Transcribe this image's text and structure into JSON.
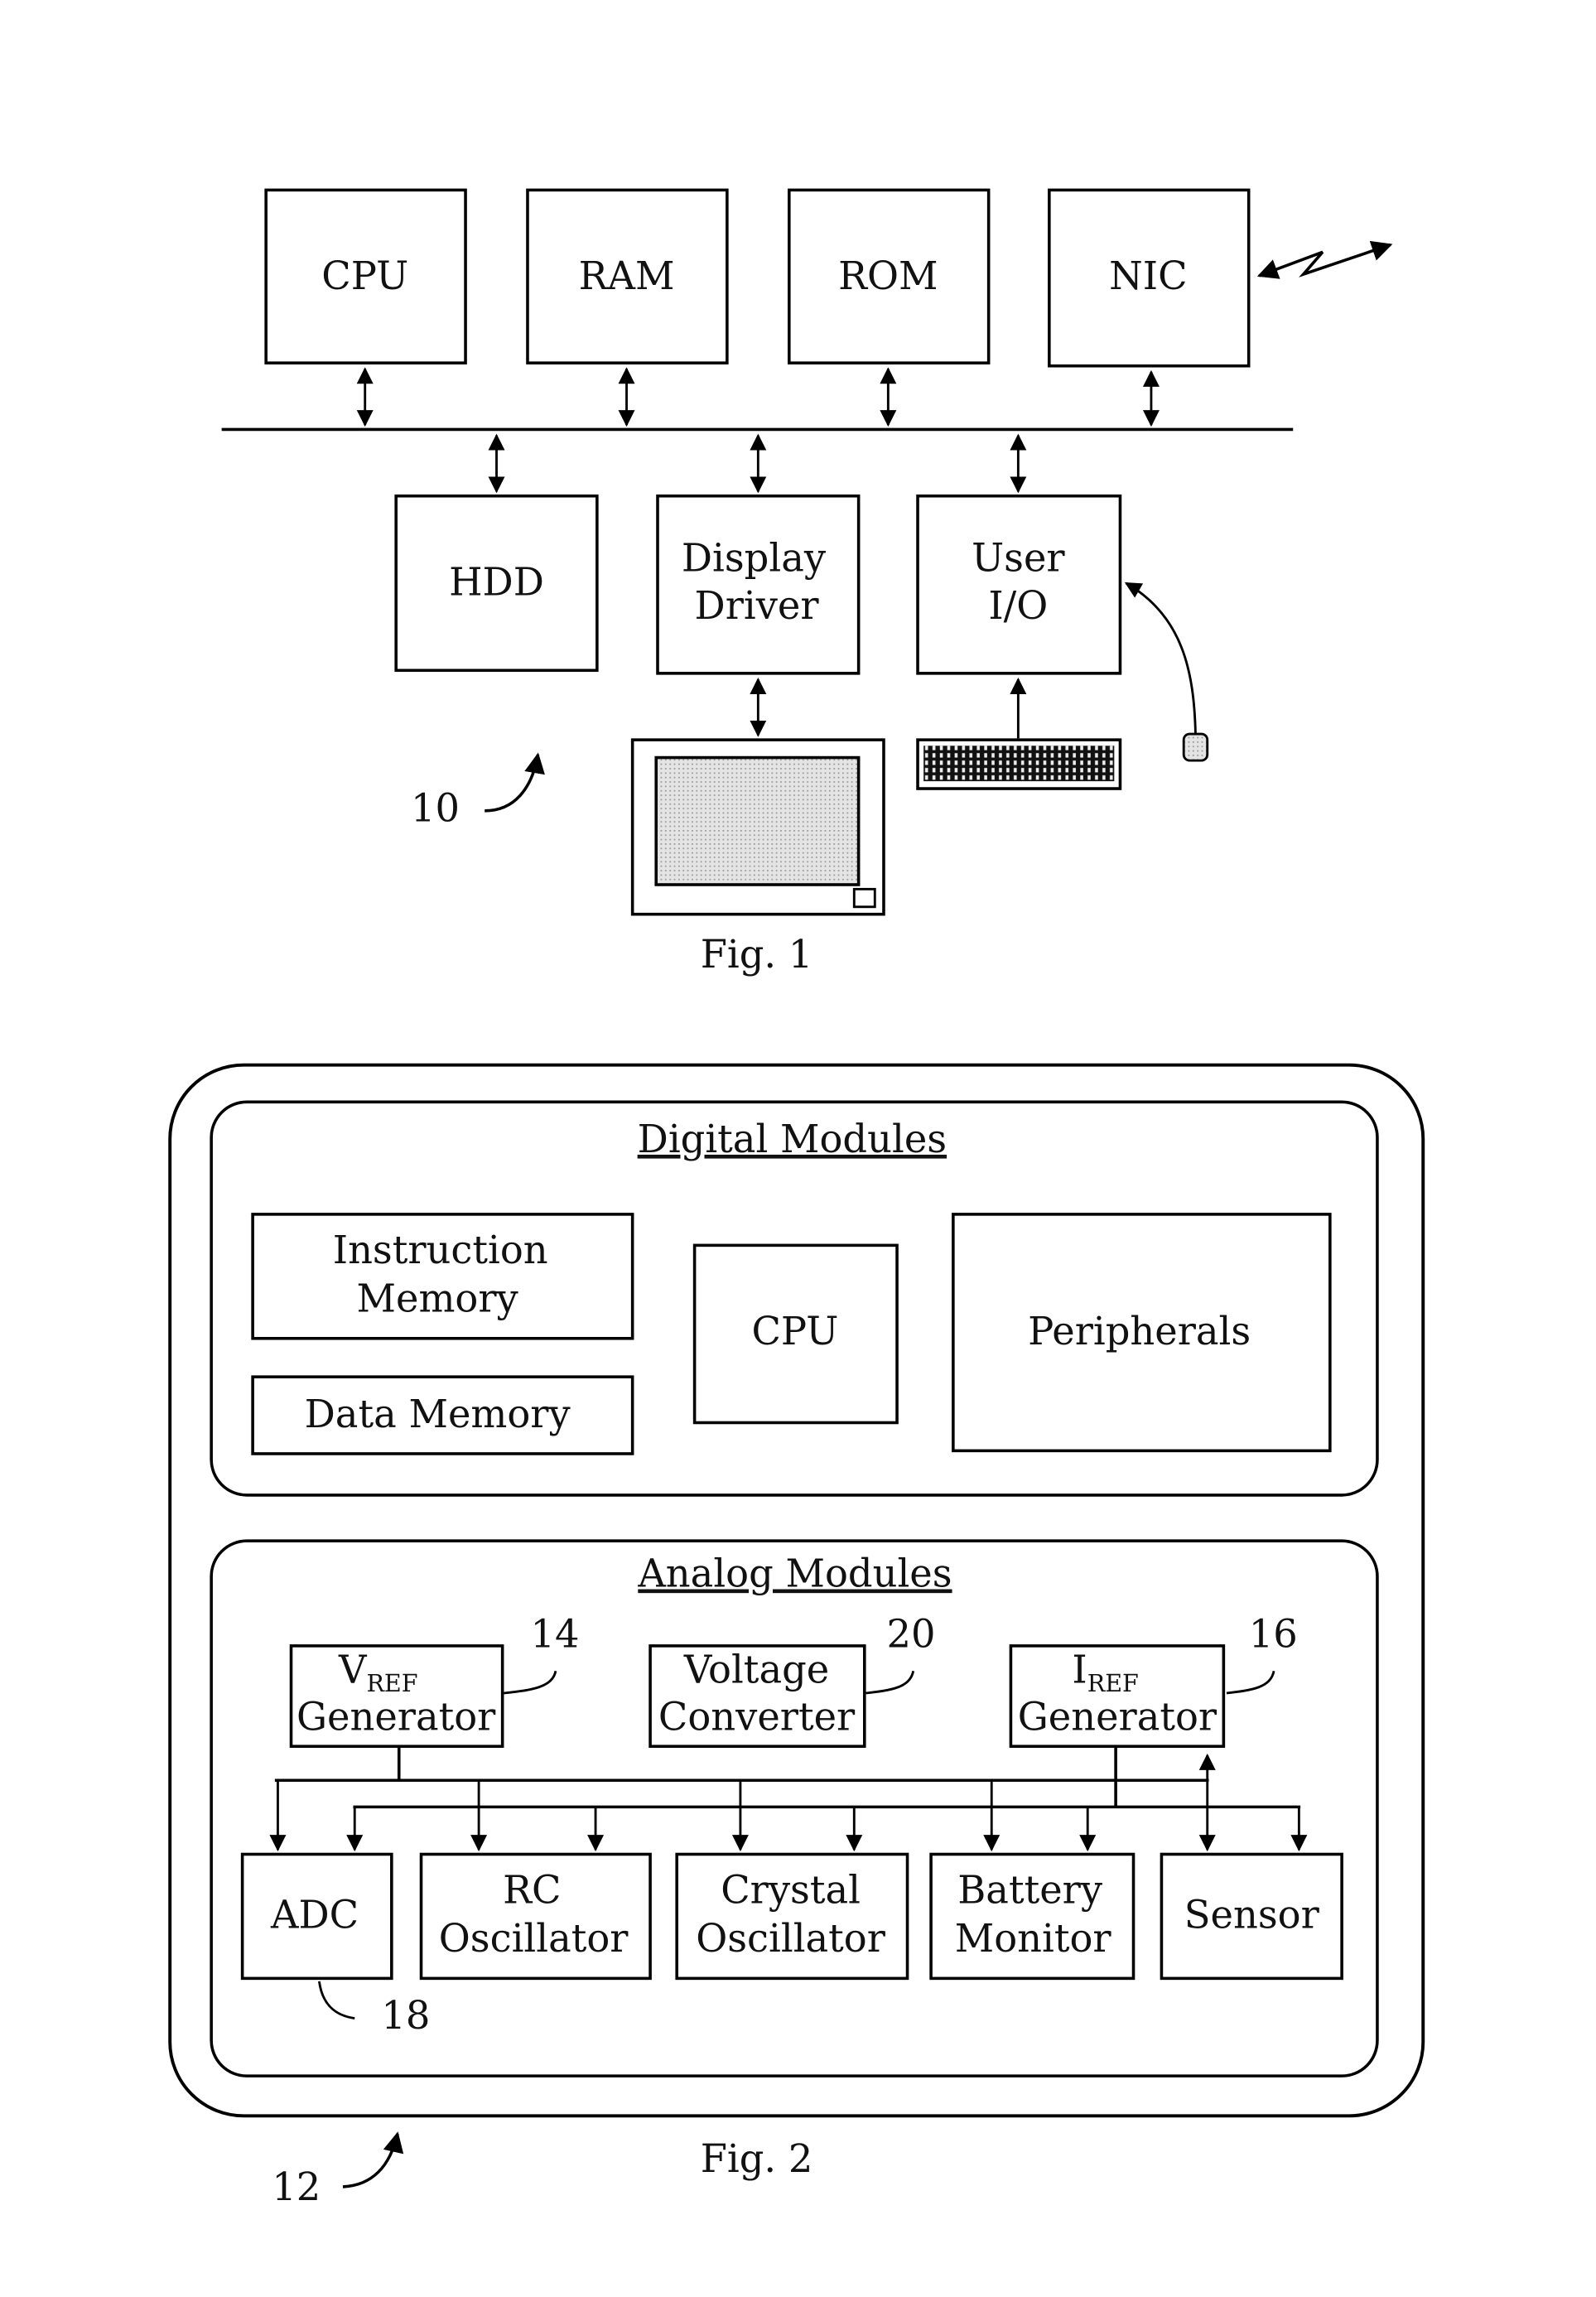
{
  "fig1": {
    "caption": "Fig. 1",
    "reference": "10",
    "top_row": [
      {
        "id": "cpu",
        "label": "CPU"
      },
      {
        "id": "ram",
        "label": "RAM"
      },
      {
        "id": "rom",
        "label": "ROM"
      },
      {
        "id": "nic",
        "label": "NIC"
      }
    ],
    "bottom_row": [
      {
        "id": "hdd",
        "label_lines": [
          "HDD"
        ]
      },
      {
        "id": "display-driver",
        "label_lines": [
          "Display",
          "Driver"
        ]
      },
      {
        "id": "user-io",
        "label_lines": [
          "User",
          "I/O"
        ]
      }
    ],
    "peripherals": [
      "monitor",
      "keyboard",
      "mouse"
    ],
    "icons": [
      "wireless-link-icon",
      "monitor-icon",
      "keyboard-icon",
      "mouse-icon"
    ]
  },
  "fig2": {
    "caption": "Fig. 2",
    "reference": "12",
    "digital": {
      "title": "Digital Modules",
      "instruction_memory": [
        "Instruction",
        "Memory"
      ],
      "data_memory": "Data Memory",
      "cpu": "CPU",
      "peripherals": "Peripherals"
    },
    "analog": {
      "title": "Analog Modules",
      "vref": {
        "main": "V",
        "sub": "REF",
        "line2": "Generator",
        "ref": "14"
      },
      "voltage_converter": {
        "lines": [
          "Voltage",
          "Converter"
        ],
        "ref": "20"
      },
      "iref": {
        "main": "I",
        "sub": "REF",
        "line2": "Generator",
        "ref": "16"
      },
      "bottom_row": [
        {
          "id": "adc",
          "label_lines": [
            "ADC"
          ],
          "ref": "18"
        },
        {
          "id": "rc-oscillator",
          "label_lines": [
            "RC",
            "Oscillator"
          ]
        },
        {
          "id": "crystal-oscillator",
          "label_lines": [
            "Crystal",
            "Oscillator"
          ]
        },
        {
          "id": "battery-monitor",
          "label_lines": [
            "Battery",
            "Monitor"
          ]
        },
        {
          "id": "sensor",
          "label_lines": [
            "Sensor"
          ]
        }
      ]
    }
  }
}
